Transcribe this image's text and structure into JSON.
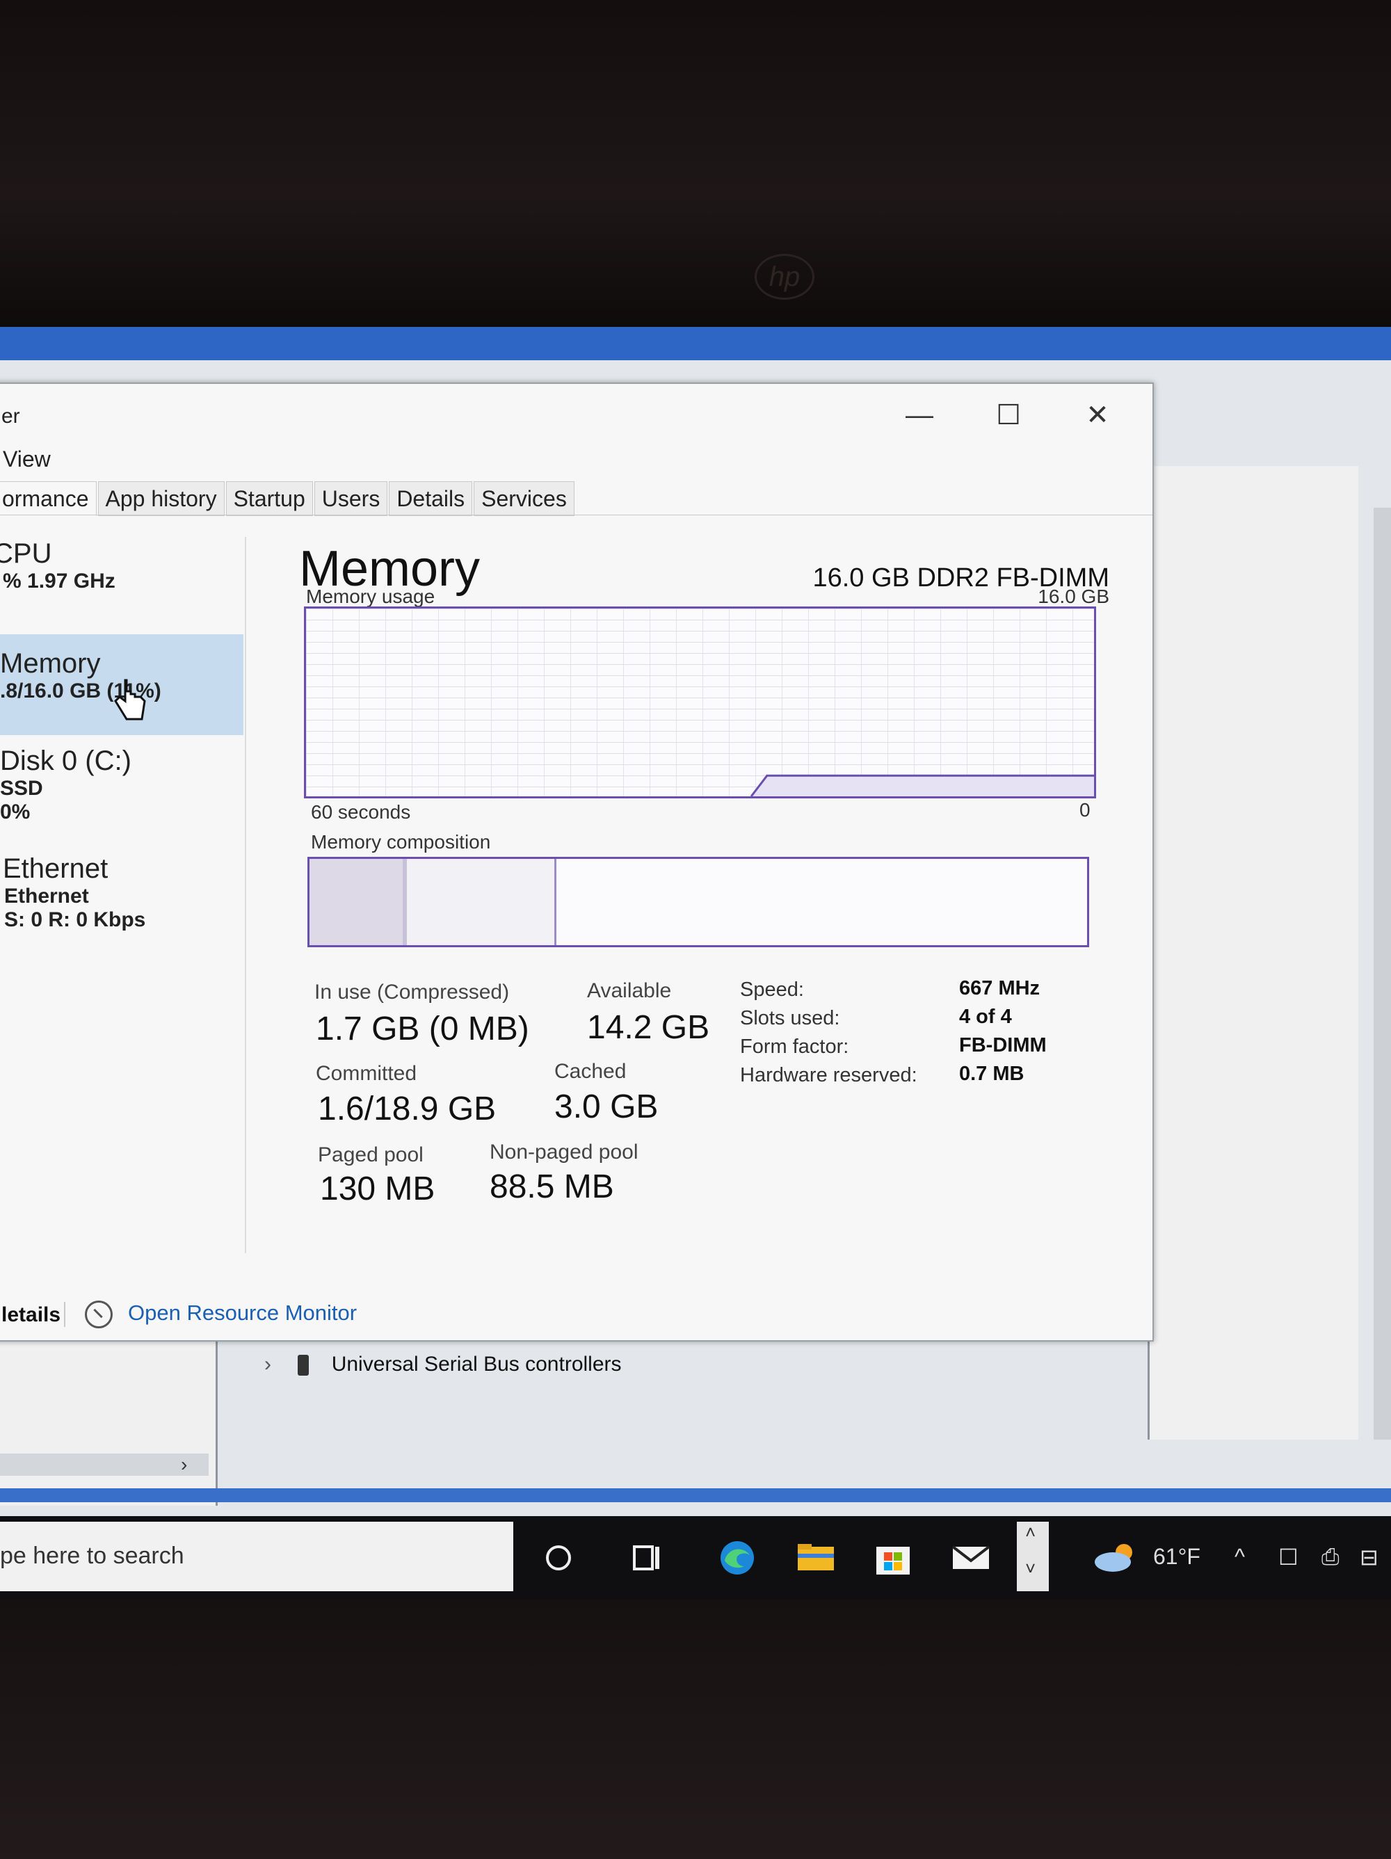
{
  "window": {
    "title": "er",
    "menu": [
      "View"
    ],
    "tabs": [
      "ormance",
      "App history",
      "Startup",
      "Users",
      "Details",
      "Services"
    ],
    "controls": {
      "minimize": "—",
      "maximize": "☐",
      "close": "✕"
    }
  },
  "sidebar": {
    "items": [
      {
        "name": "CPU",
        "detail": "% 1.97 GHz"
      },
      {
        "name": "Memory",
        "detail": ".8/16.0 GB (11%)"
      },
      {
        "name": "Disk 0 (C:)",
        "detail": "SSD",
        "detail2": "0%"
      },
      {
        "name": "Ethernet",
        "detail": "Ethernet",
        "detail2": "S: 0 R: 0 Kbps"
      }
    ]
  },
  "memory": {
    "heading": "Memory",
    "type": "16.0 GB DDR2 FB-DIMM",
    "usage_label": "Memory usage",
    "usage_max": "16.0 GB",
    "time_label": "60 seconds",
    "zero_label": "0",
    "composition_label": "Memory composition",
    "usage_fraction": 0.11,
    "composition": {
      "in_use_fraction": 0.12,
      "modified_fraction": 0.005,
      "standby_fraction": 0.19
    },
    "stats": {
      "in_use_label": "In use (Compressed)",
      "in_use_value": "1.7 GB (0 MB)",
      "available_label": "Available",
      "available_value": "14.2 GB",
      "committed_label": "Committed",
      "committed_value": "1.6/18.9 GB",
      "cached_label": "Cached",
      "cached_value": "3.0 GB",
      "paged_label": "Paged pool",
      "paged_value": "130 MB",
      "nonpaged_label": "Non-paged pool",
      "nonpaged_value": "88.5 MB"
    },
    "specs": {
      "speed_label": "Speed:",
      "speed_value": "667 MHz",
      "slots_label": "Slots used:",
      "slots_value": "4 of 4",
      "form_label": "Form factor:",
      "form_value": "FB-DIMM",
      "reserved_label": "Hardware reserved:",
      "reserved_value": "0.7 MB"
    }
  },
  "footer": {
    "details": "letails",
    "resource_monitor": "Open Resource Monitor"
  },
  "device_manager": {
    "usb_row": "Universal Serial Bus controllers"
  },
  "taskbar": {
    "search_placeholder": "pe here to search",
    "weather": "61°F",
    "icons": [
      "cortana-icon",
      "task-view-icon",
      "edge-icon",
      "file-explorer-icon",
      "store-icon",
      "mail-icon"
    ]
  },
  "colors": {
    "graph_border": "#6a4fb0",
    "selection": "#c6dcee",
    "link": "#1a5fb4"
  }
}
